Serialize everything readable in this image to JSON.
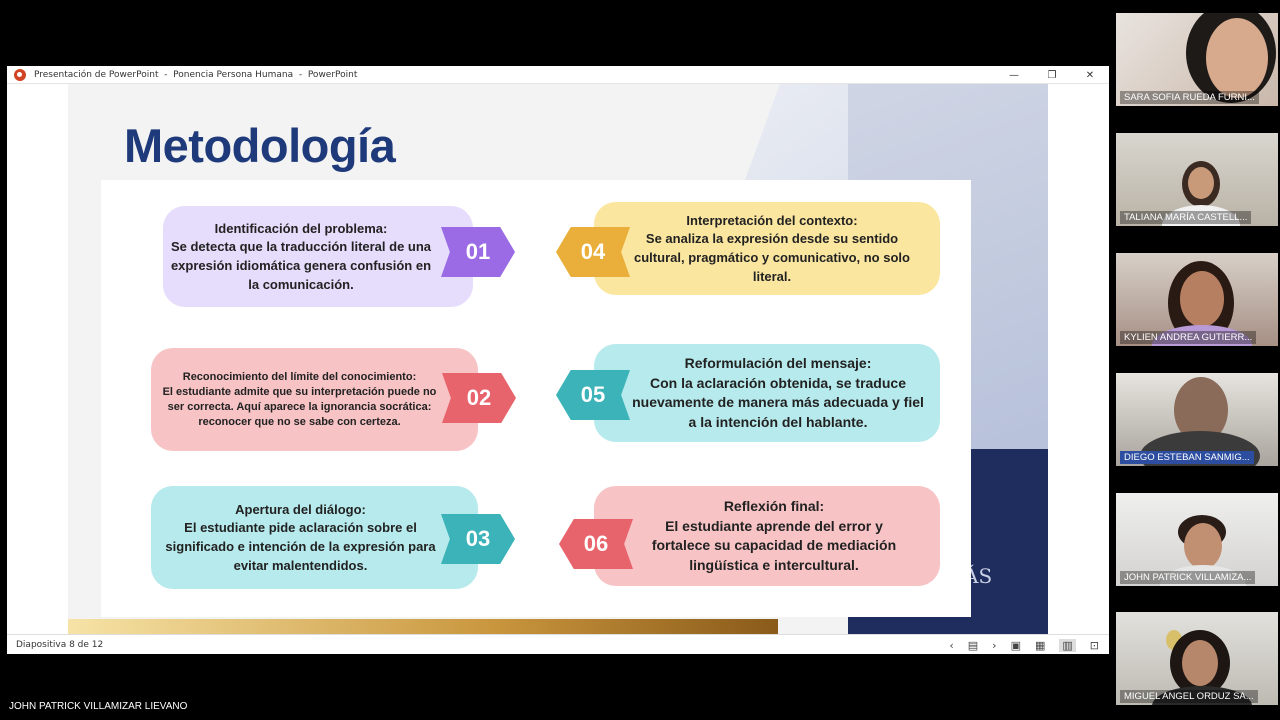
{
  "window": {
    "title": "Presentación de PowerPoint  -  Ponencia Persona Humana  -  PowerPoint",
    "minimize": "—",
    "maximize": "❐",
    "close": "✕"
  },
  "slide": {
    "title": "Metodología",
    "logo_text": "ÁS",
    "steps": [
      {
        "number": "01",
        "heading": "Identificación del problema:",
        "body": "Se detecta que la traducción literal de una expresión idiomática genera confusión en la comunicación.",
        "color": "#e6dcfb",
        "badge_color": "#9b6be6"
      },
      {
        "number": "02",
        "heading": "Reconocimiento del límite del conocimiento:",
        "body": "El estudiante admite que su interpretación puede no ser correcta. Aquí aparece la ignorancia socrática: reconocer que no se sabe con certeza.",
        "color": "#f7c3c5",
        "badge_color": "#e8646c"
      },
      {
        "number": "03",
        "heading": "Apertura del diálogo:",
        "body": "El estudiante pide aclaración sobre el significado e intención de la expresión para evitar malentendidos.",
        "color": "#b7eaec",
        "badge_color": "#3bb3b8"
      },
      {
        "number": "04",
        "heading": "Interpretación del contexto:",
        "body": "Se analiza la expresión desde su sentido cultural, pragmático y comunicativo, no solo literal.",
        "color": "#fbe6a0",
        "badge_color": "#eaae3a"
      },
      {
        "number": "05",
        "heading": "Reformulación del mensaje:",
        "body": "Con la aclaración obtenida, se traduce nuevamente de manera más adecuada y fiel a la intención del hablante.",
        "color": "#b7eaec",
        "badge_color": "#3bb3b8"
      },
      {
        "number": "06",
        "heading": "Reflexión final:",
        "body": "El estudiante aprende del error y fortalece su capacidad de mediación lingüística e intercultural.",
        "color": "#f7c3c5",
        "badge_color": "#e8646c"
      }
    ]
  },
  "statusbar": {
    "slide_counter": "Diapositiva 8 de 12",
    "icons": [
      "prev-icon",
      "notes-icon",
      "next-icon",
      "normal-view-icon",
      "grid-view-icon",
      "reading-view-icon",
      "presenter-view-icon"
    ]
  },
  "presenter": "JOHN PATRICK VILLAMIZAR LIEVANO",
  "participants": [
    "SARA SOFIA RUEDA FURNI...",
    "TALIANA MARÍA CASTELL...",
    "KYLIEN ANDREA GUTIERR...",
    "DIEGO ESTEBAN SANMIG...",
    "JOHN PATRICK VILLAMIZA...",
    "MIGUEL ANGEL ORDUZ SA..."
  ]
}
